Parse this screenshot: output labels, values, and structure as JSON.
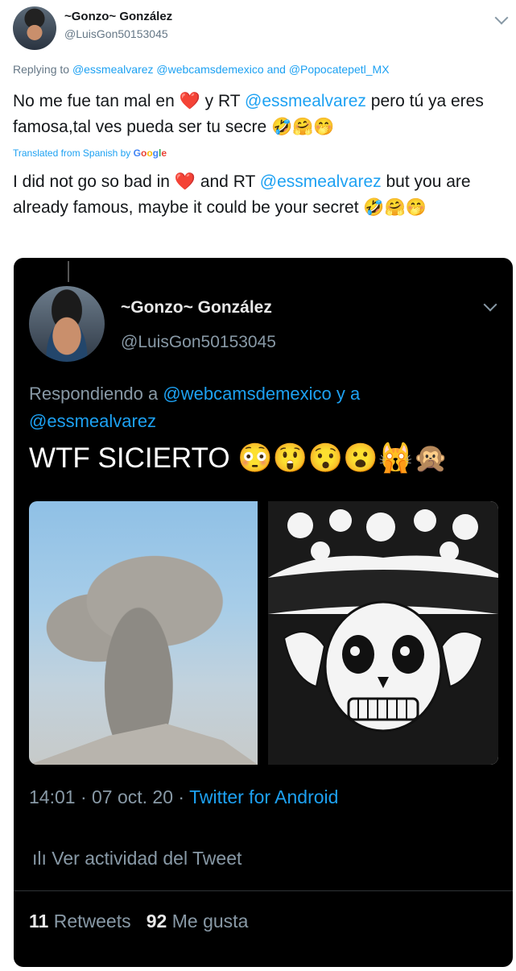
{
  "outer_tweet": {
    "author_name": "~Gonzo~ González",
    "author_handle": "@LuisGon50153045",
    "replying_label": "Replying to",
    "replying_mentions_1": "@essmealvarez @webcamsdemexico",
    "replying_and": "and",
    "replying_mentions_2": "@Popocatepetl_MX",
    "text_es_part1": "No me fue tan mal en",
    "text_es_part2": "y RT",
    "text_es_mention": "@essmealvarez",
    "text_es_part3": "pero tú ya eres famosa,tal ves pueda ser tu secre",
    "text_es_emojis": "🤣🤗🤭",
    "translated_label": "Translated from Spanish by",
    "translated_by": "Google",
    "text_en_part1": "I did not go so bad in",
    "text_en_part2": "and RT",
    "text_en_mention": "@essmealvarez",
    "text_en_part3": "but you are already famous, maybe it could be your secret",
    "text_en_emojis": "🤣🤗🤭",
    "heart": "❤️"
  },
  "embedded_tweet": {
    "author_name": "~Gonzo~ González",
    "author_handle": "@LuisGon50153045",
    "replying_label": "Respondiendo a",
    "replying_mentions": "@webcamsdemexico y a @essmealvarez",
    "text": "WTF SICIERTO",
    "text_emojis": "😳😲😯😮🙀🙊",
    "time": "14:01 · 07 oct. 20 ·",
    "source": "Twitter for Android",
    "activity_label": "Ver actividad del Tweet",
    "retweets_count": "11",
    "retweets_label": "Retweets",
    "likes_count": "92",
    "likes_label": "Me gusta"
  },
  "colors": {
    "link": "#1da1f2",
    "muted": "#8899a6",
    "embed_bg": "#000000"
  },
  "icons": [
    "avatar",
    "chevron-down-icon",
    "heart-icon",
    "analytics-icon"
  ]
}
